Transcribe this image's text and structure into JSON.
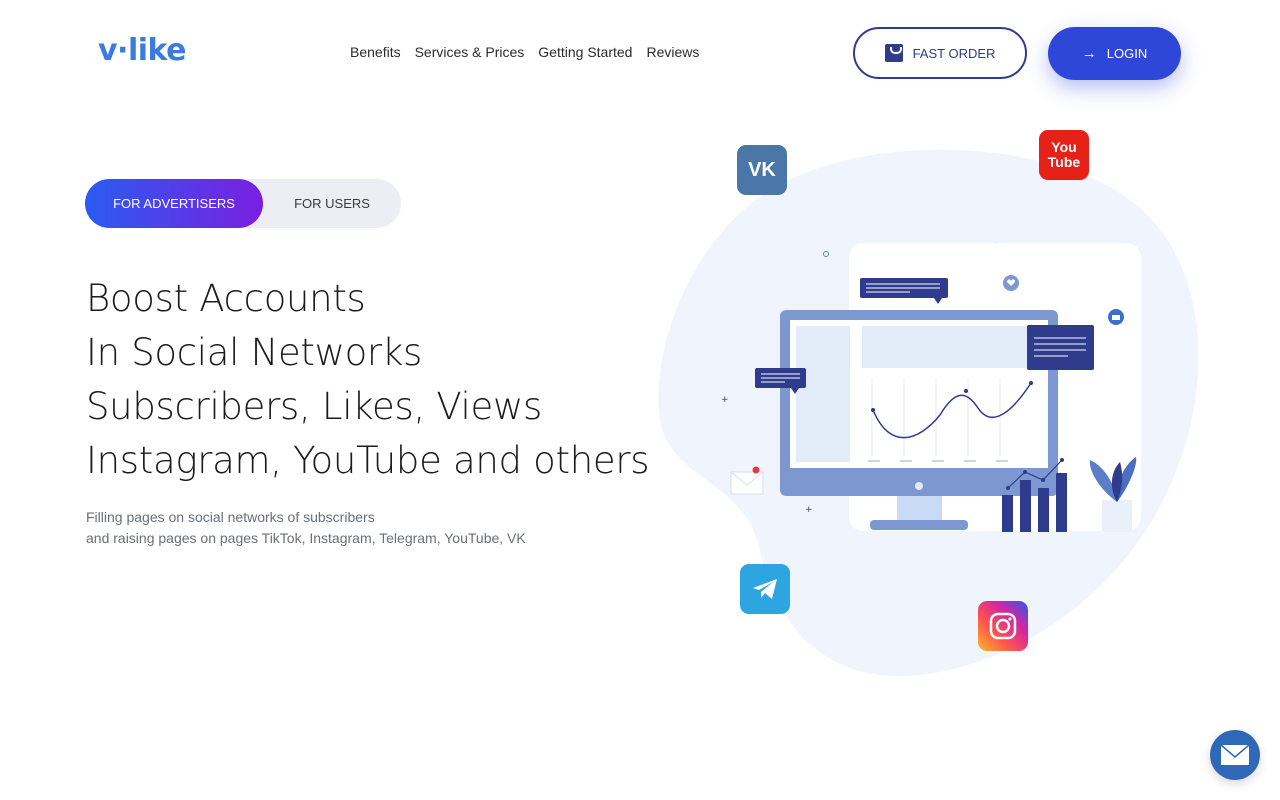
{
  "header": {
    "logo": "v·like",
    "nav": [
      "Benefits",
      "Services & Prices",
      "Getting Started",
      "Reviews"
    ],
    "fast_order": "FAST ORDER",
    "login": "LOGIN"
  },
  "toggle": {
    "advertisers": "FOR ADVERTISERS",
    "users": "FOR USERS"
  },
  "hero": {
    "lines": [
      "Boost Accounts",
      "In Social Networks",
      "Subscribers, Likes, Views",
      "Instagram, YouTube and others"
    ],
    "sub1": "Filling pages on social networks of subscribers",
    "sub2": "and raising pages on pages TikTok, Instagram, Telegram, YouTube, VK"
  },
  "social": {
    "vk": "VK",
    "youtube_top": "You",
    "youtube_bottom": "Tube"
  },
  "colors": {
    "accent": "#2f47d9",
    "navy": "#2f3b8c",
    "logo": "#3a7be0",
    "gradient_start": "#2a5cf2",
    "gradient_end": "#7a1fe0",
    "vk": "#4a76a8",
    "youtube": "#e62117",
    "telegram": "#2ca5e0"
  },
  "icons": [
    "shopping-bag-icon",
    "arrow-right-icon",
    "vk-icon",
    "youtube-icon",
    "telegram-icon",
    "instagram-icon",
    "mail-icon"
  ]
}
